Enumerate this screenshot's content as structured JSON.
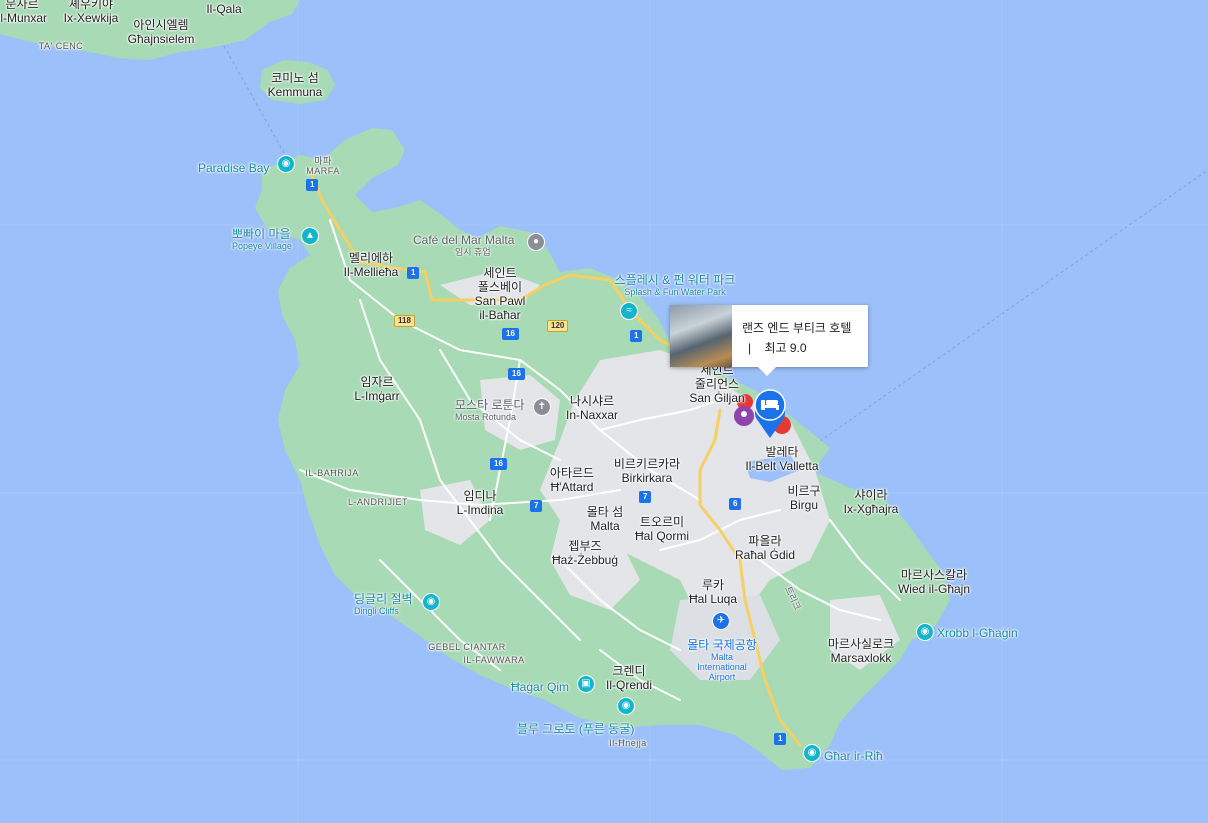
{
  "map": {
    "colors": {
      "sea": "#9cc0f9",
      "land": "#a8dab5",
      "urban": "#e8eaed",
      "road": "#ffffff",
      "highway": "#f6cf65"
    }
  },
  "places": {
    "munxar_ko": "문사르",
    "munxar": "Il-Munxar",
    "xewkija_ko": "셰우키야",
    "xewkija": "Ix-Xewkija",
    "qala": "Il-Qala",
    "ghajnsielem_ko": "아인시엘렘",
    "ghajnsielem": "Għajnsielem",
    "ta_cenc": "TA' ĊENĊ",
    "comino_ko": "코미노 섬",
    "comino": "Kemmuna",
    "marfa_ko": "마파",
    "marfa": "MARFA",
    "mellieha_ko": "멜리에하",
    "mellieha": "Il-Mellieħa",
    "spb_ko1": "세인트",
    "spb_ko2": "폴스베이",
    "spb1": "San Pawl",
    "spb2": "il-Baħar",
    "mgarr_ko": "임자르",
    "mgarr": "L-Imġarr",
    "naxxar_ko": "나시샤르",
    "naxxar": "In-Naxxar",
    "stj_ko1": "세인트",
    "stj_ko2": "줄리언스",
    "stj": "San Ġiljan",
    "bahrija": "IL-BAĦRIJA",
    "andrijiet": "L-ANDRIJIET",
    "mdina_ko": "임디나",
    "mdina": "L-Imdina",
    "attard_ko": "아타르드",
    "attard": "Ħ'Attard",
    "bkara_ko": "비르키르카라",
    "bkara": "Birkirkara",
    "valletta_ko": "발레타",
    "valletta": "Il-Belt Valletta",
    "birgu_ko": "비르구",
    "birgu": "Birgu",
    "xghajra_ko": "샤이라",
    "xghajra": "Ix-Xgħajra",
    "malta_ko": "몰타 섬",
    "malta": "Malta",
    "qormi_ko": "트오르미",
    "qormi": "Ħal Qormi",
    "paola_ko": "파올라",
    "paola": "Raħal Ġdid",
    "zebbug_ko": "젭부즈",
    "zebbug": "Ħaż-Żebbuġ",
    "luqa_ko": "루카",
    "luqa": "Ħal Luqa",
    "wied_ko": "마르사스칼라",
    "wied": "Wied il-Għajn",
    "gebel": "GEBEL CIANTAR",
    "fawwara": "IL-FAWWARA",
    "qrendi_ko": "크렌디",
    "qrendi": "Il-Qrendi",
    "marsa_ko": "마르사실로크",
    "marsa": "Marsaxlokk",
    "hnejja": "Il-Ħnejja"
  },
  "pois": {
    "paradise_bay": "Paradise Bay",
    "popeye_ko": "뽀빠이 마을",
    "popeye": "Popeye Village",
    "cafe_del_mar": "Café del Mar Malta",
    "cafe_sub": "임시 휴업",
    "splash_ko": "스플레시 & 펀 워터 파크",
    "splash": "Splash & Fun Water Park",
    "rotunda_ko": "모스타 로툰다",
    "rotunda": "Mosta Rotunda",
    "dingli_ko": "딩글리 절벽",
    "dingli": "Dingli Cliffs",
    "hagar_qim": "Ħaġar Qim",
    "blue_grotto": "블루 그로토 (푸른 동굴)",
    "airport_ko": "몰타 국제공항",
    "airport1": "Malta",
    "airport2": "International",
    "airport3": "Airport",
    "xrobb": "Xrobb l-Għaġin",
    "ghar": "Għar ir-Riħ",
    "triq": "트리크"
  },
  "roads": {
    "r1a": "1",
    "r1b": "1",
    "r1c": "1",
    "r1d": "1",
    "r118": "118",
    "r120": "120",
    "r16a": "16",
    "r16b": "16",
    "r16c": "16",
    "r7": "7",
    "r6": "6"
  },
  "infowindow": {
    "hotel_name": "랜즈 엔드 부티크 호텔",
    "separator": "|",
    "rating_text": "최고 9.0"
  },
  "markers": {
    "hotel_icon": "hotel-bed-icon",
    "airport_icon": "airplane-icon"
  }
}
